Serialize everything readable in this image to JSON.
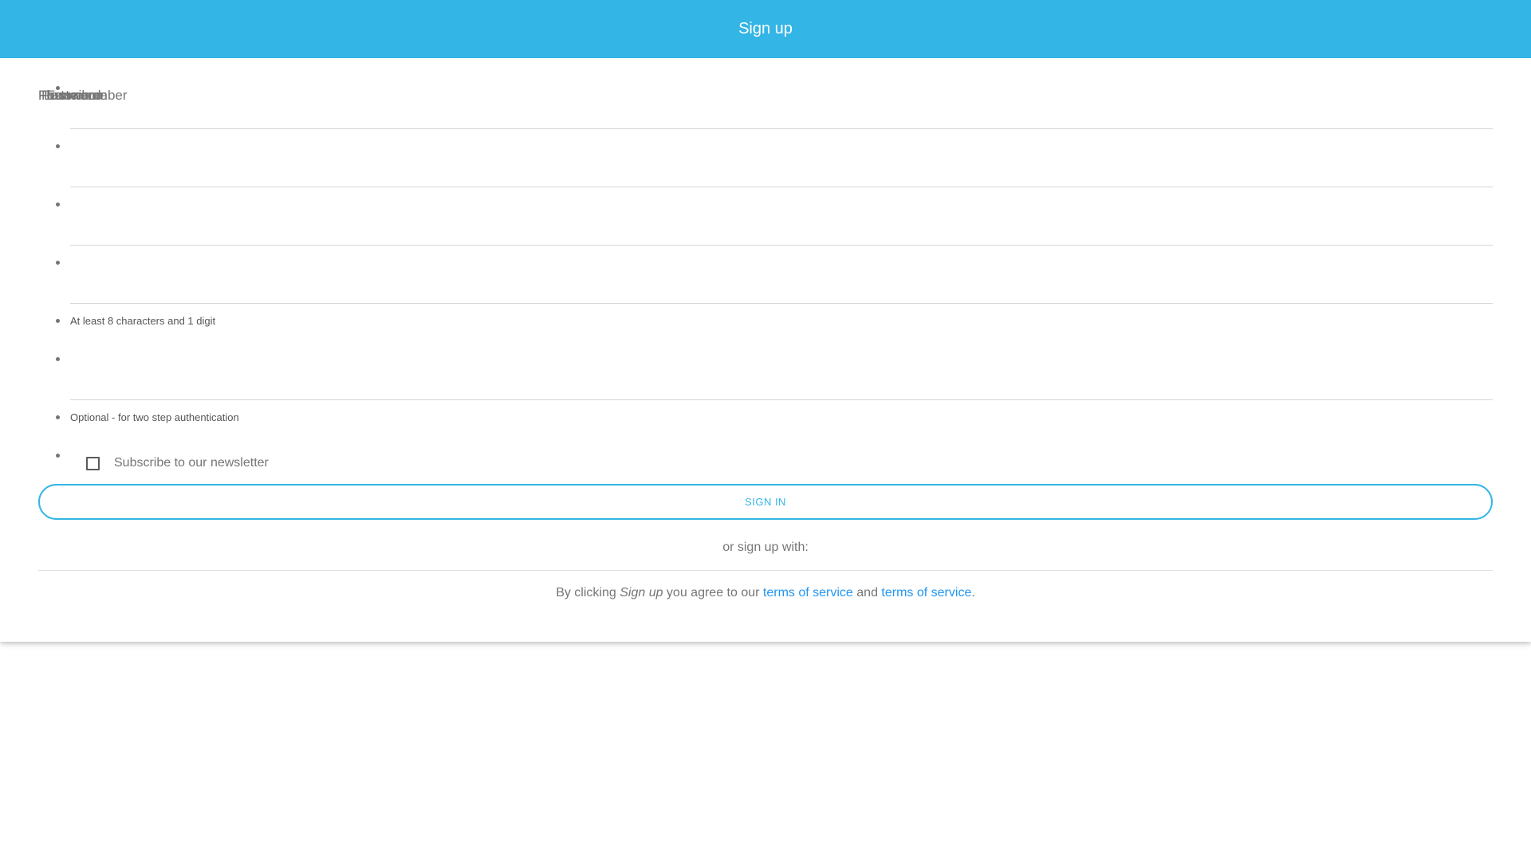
{
  "header": {
    "title": "Sign up"
  },
  "form": {
    "overlapped_labels": [
      "First name",
      "Last name",
      "E-mail",
      "Password",
      "Phone number"
    ],
    "password_hint": "At least 8 characters and 1 digit",
    "phone_hint": "Optional - for two step authentication",
    "newsletter_label": "Subscribe to our newsletter",
    "submit_label": "SIGN IN"
  },
  "footer": {
    "or_text": "or sign up with:",
    "terms_prefix": "By clicking ",
    "terms_emphasis": "Sign up",
    "terms_middle": " you agree to our ",
    "terms_link_1": "terms of service",
    "terms_and": " and ",
    "terms_link_2": "terms of service",
    "terms_suffix": "."
  },
  "colors": {
    "accent": "#33b5e5",
    "link": "#2196f3",
    "text": "#757575"
  }
}
